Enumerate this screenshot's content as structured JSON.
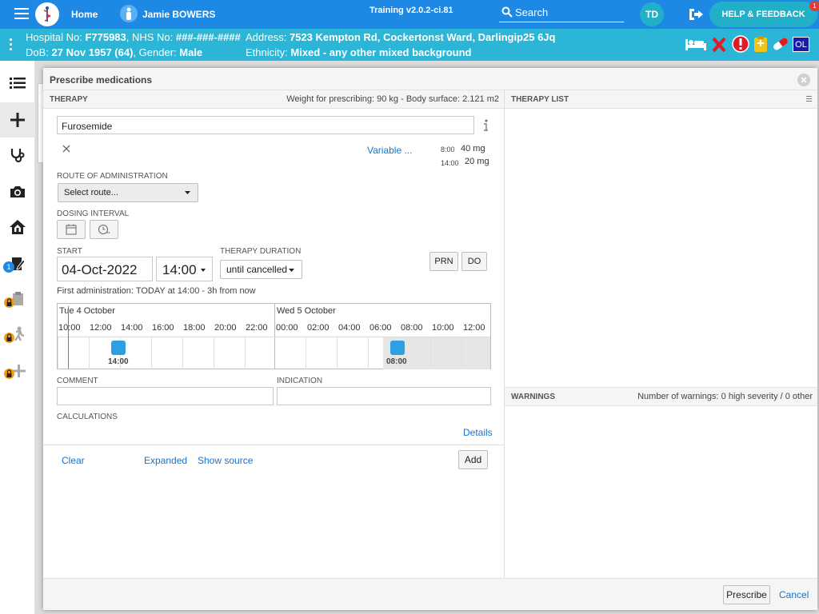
{
  "topbar": {
    "home": "Home",
    "patient_name": "Jamie BOWERS",
    "version": "Training v2.0.2-ci.81",
    "search": "Search",
    "initials": "TD",
    "help": "HELP & FEEDBACK",
    "help_badge": "1"
  },
  "patient": {
    "hospital_label": "Hospital No:",
    "hospital_no": "F775983",
    "nhs_label": ", NHS No:",
    "nhs_no": "###-###-####",
    "dob_label": "DoB:",
    "dob": "27 Nov 1957 (64)",
    "gender_label": ", Gender:",
    "gender": "Male",
    "address_label": "Address:",
    "address": "7523 Kempton Rd, Cockertonst Ward, Darlingip25 6Jq",
    "ethnicity_label": "Ethnicity:",
    "ethnicity": "Mixed - any other mixed background",
    "ol_badge": "OL"
  },
  "sidenav": {
    "badge": "1"
  },
  "modal": {
    "title": "Prescribe medications",
    "therapy_header": "THERAPY",
    "weight_info": "Weight for prescribing: 90 kg - Body surface: 2.121 m2",
    "therapy_list_header": "THERAPY LIST",
    "medication": "Furosemide",
    "variable": "Variable ...",
    "doses": [
      {
        "time": "8:00",
        "dose": "40 mg"
      },
      {
        "time": "14:00",
        "dose": "20 mg"
      }
    ],
    "route_label": "ROUTE OF ADMINISTRATION",
    "route_placeholder": "Select route...",
    "dosing_label": "DOSING INTERVAL",
    "start_label": "START",
    "start_date": "04-Oct-2022",
    "start_time": "14:00",
    "duration_label": "THERAPY DURATION",
    "duration": "until cancelled",
    "prn": "PRN",
    "do": "DO",
    "first_admin": "First administration: TODAY at 14:00 - 3h from now",
    "timeline": {
      "day1": "Tue 4 October",
      "day2": "Wed 5 October",
      "hours1": [
        "10:00",
        "12:00",
        "14:00",
        "16:00",
        "18:00",
        "20:00",
        "22:00"
      ],
      "hours2": [
        "00:00",
        "02:00",
        "04:00",
        "06:00",
        "08:00",
        "10:00",
        "12:00"
      ],
      "marker1": "14:00",
      "marker2": "08:00"
    },
    "comment_label": "COMMENT",
    "indication_label": "INDICATION",
    "calculations_label": "CALCULATIONS",
    "details": "Details",
    "clear": "Clear",
    "expanded": "Expanded",
    "show_source": "Show source",
    "add": "Add",
    "warnings_header": "WARNINGS",
    "warnings_info": "Number of warnings: 0 high severity / 0 other",
    "prescribe": "Prescribe",
    "cancel": "Cancel"
  }
}
